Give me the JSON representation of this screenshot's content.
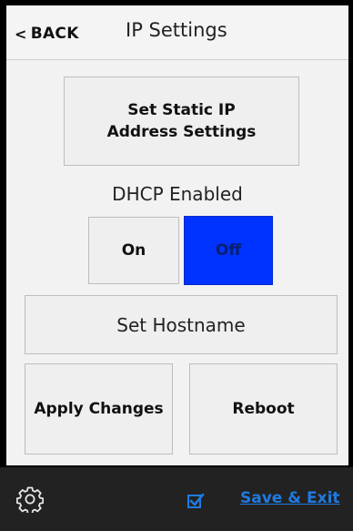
{
  "header": {
    "back_label": "BACK",
    "back_chevron": "<",
    "title": "IP Settings"
  },
  "main": {
    "static_ip_button": "Set Static IP Address Settings",
    "dhcp_label": "DHCP Enabled",
    "dhcp_on": "On",
    "dhcp_off": "Off",
    "dhcp_selected": "Off",
    "hostname_button": "Set Hostname",
    "apply_button": "Apply Changes",
    "reboot_button": "Reboot"
  },
  "footer": {
    "settings_icon": "gear-icon",
    "checkbox_icon": "checkbox-checked-icon",
    "save_exit_label": "Save & Exit"
  },
  "colors": {
    "selected": "#0033ff",
    "link": "#1f7ae0",
    "footer_bg": "#222222",
    "panel_bg": "#f2f2f2"
  }
}
